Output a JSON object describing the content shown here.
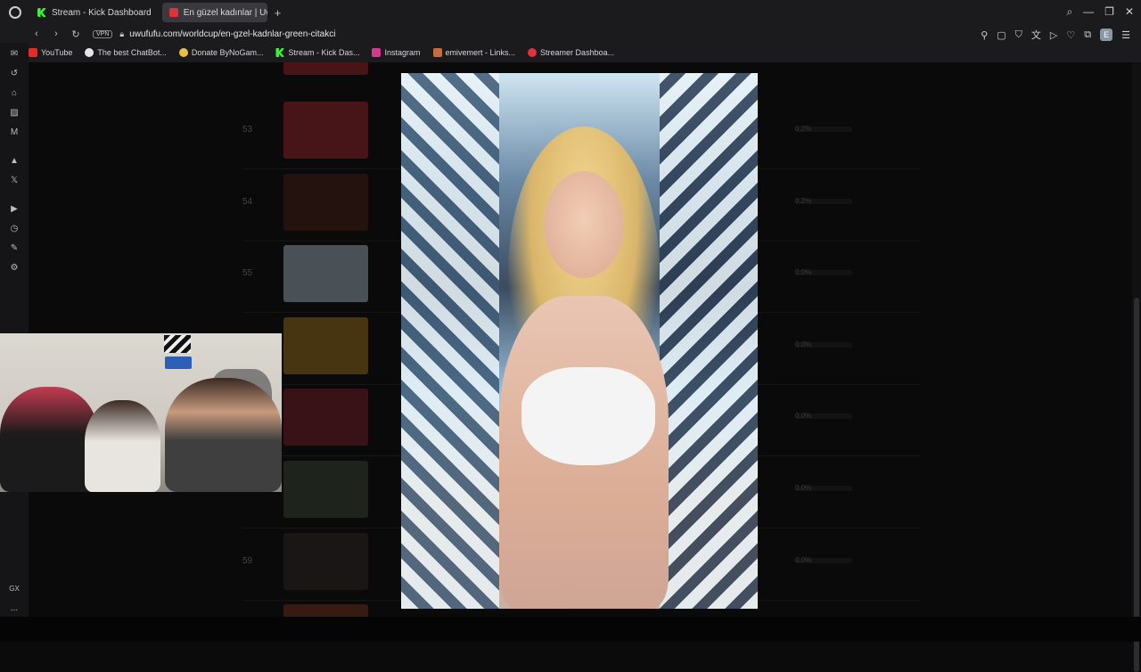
{
  "browser": {
    "tabs": [
      {
        "label": "Stream - Kick Dashboard",
        "active": false
      },
      {
        "label": "En güzel kadınlar | UwUf",
        "active": true
      }
    ],
    "new_tab": "+",
    "url": "uwufufu.com/worldcup/en-gzel-kadnlar-green-citakci",
    "vpn_label": "VPN",
    "profile_initial": "E"
  },
  "bookmarks": [
    {
      "label": "YouTube",
      "color": "#e52d27"
    },
    {
      "label": "The best ChatBot...",
      "color": "#e6e6e6"
    },
    {
      "label": "Donate ByNoGam...",
      "color": "#e8c046"
    },
    {
      "label": "Stream - Kick Das...",
      "color": "#3cf13c"
    },
    {
      "label": "Instagram",
      "color": "#d6378f"
    },
    {
      "label": "emivemert - Links...",
      "color": "#c96b3d"
    },
    {
      "label": "Streamer Dashboa...",
      "color": "#e0313c"
    }
  ],
  "sidebar_icons": [
    "messenger-icon",
    "history-icon",
    "pinboard-icon",
    "wallet-icon",
    "news-icon",
    "aria-icon",
    "x-icon",
    "player-icon",
    "clock-icon",
    "extensions-icon",
    "settings-icon",
    "gx-label",
    "more-icon"
  ],
  "sidebar_gx": "GX",
  "sidebar_more": "...",
  "ranking": [
    {
      "rank": "53",
      "pct": "0.2%",
      "thumb": "#7a1f22"
    },
    {
      "rank": "54",
      "pct": "0.2%",
      "thumb": "#3a1a14"
    },
    {
      "rank": "55",
      "pct": "0.0%",
      "thumb": "#7f8c96"
    },
    {
      "rank": "",
      "pct": "0.0%",
      "thumb": "#7a5a1a"
    },
    {
      "rank": "",
      "pct": "0.0%",
      "thumb": "#5e1a22"
    },
    {
      "rank": "",
      "pct": "0.0%",
      "thumb": "#2f3a2a"
    },
    {
      "rank": "59",
      "pct": "0.0%",
      "thumb": "#2a2020"
    }
  ],
  "colors": {
    "chrome": "#1b1b1d",
    "page_bg": "#0a0a0b",
    "accent_kick": "#3cf13c",
    "accent_uwu": "#e0313c"
  }
}
